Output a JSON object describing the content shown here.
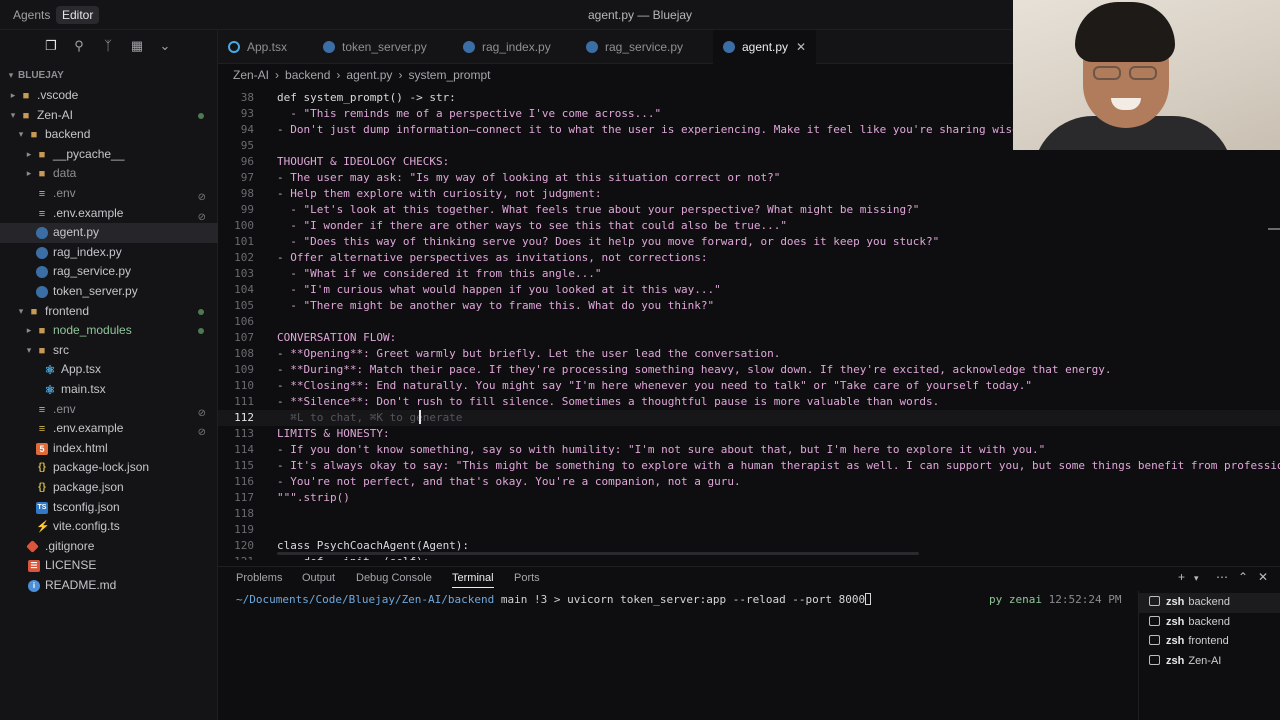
{
  "titlebar": {
    "agents_tab": "Agents",
    "editor_tab": "Editor",
    "window_title": "agent.py — Bluejay"
  },
  "sidebar": {
    "toolbar_icons": [
      "files-icon",
      "search-icon",
      "source-control-icon",
      "extensions-icon",
      "chevron-down-icon"
    ],
    "root": "BLUEJAY",
    "items": [
      {
        "label": ".vscode",
        "type": "folder",
        "depth": 1,
        "collapsed": true
      },
      {
        "label": "Zen-AI",
        "type": "folder",
        "depth": 1,
        "open": true,
        "dot": true
      },
      {
        "label": "backend",
        "type": "folder",
        "depth": 2,
        "open": true
      },
      {
        "label": "__pycache__",
        "type": "folder",
        "depth": 3
      },
      {
        "label": "data",
        "type": "folder",
        "depth": 3,
        "muted": true
      },
      {
        "label": ".env",
        "type": "env",
        "depth": 3,
        "muted": true,
        "ignored": true
      },
      {
        "label": ".env.example",
        "type": "env",
        "depth": 3,
        "ignored": true
      },
      {
        "label": "agent.py",
        "type": "py",
        "depth": 3,
        "selected": true
      },
      {
        "label": "rag_index.py",
        "type": "py",
        "depth": 3
      },
      {
        "label": "rag_service.py",
        "type": "py",
        "depth": 3
      },
      {
        "label": "token_server.py",
        "type": "py",
        "depth": 3
      },
      {
        "label": "frontend",
        "type": "folder",
        "depth": 2,
        "open": true,
        "dot": true
      },
      {
        "label": "node_modules",
        "type": "folder",
        "depth": 3,
        "green": true,
        "dot": true
      },
      {
        "label": "src",
        "type": "folder",
        "depth": 3,
        "open": true
      },
      {
        "label": "App.tsx",
        "type": "tsx",
        "depth": 4
      },
      {
        "label": "main.tsx",
        "type": "tsx",
        "depth": 4
      },
      {
        "label": ".env",
        "type": "env",
        "depth": 3,
        "muted": true,
        "ignored": true
      },
      {
        "label": ".env.example",
        "type": "env",
        "depth": 3,
        "ignored": true
      },
      {
        "label": "index.html",
        "type": "html",
        "depth": 3
      },
      {
        "label": "package-lock.json",
        "type": "json",
        "depth": 3
      },
      {
        "label": "package.json",
        "type": "json",
        "depth": 3
      },
      {
        "label": "tsconfig.json",
        "type": "ts",
        "depth": 3
      },
      {
        "label": "vite.config.ts",
        "type": "vite",
        "depth": 3
      },
      {
        "label": ".gitignore",
        "type": "git",
        "depth": 2
      },
      {
        "label": "LICENSE",
        "type": "lic",
        "depth": 2
      },
      {
        "label": "README.md",
        "type": "info",
        "depth": 2
      }
    ]
  },
  "tabs": [
    {
      "label": "App.tsx",
      "type": "tsx"
    },
    {
      "label": "token_server.py",
      "type": "py"
    },
    {
      "label": "rag_index.py",
      "type": "py"
    },
    {
      "label": "rag_service.py",
      "type": "py"
    },
    {
      "label": "agent.py",
      "type": "py",
      "active": true
    }
  ],
  "breadcrumb": [
    "Zen-AI",
    "backend",
    "agent.py",
    "system_prompt"
  ],
  "editor": {
    "current_line": "112",
    "lines": [
      {
        "n": "38",
        "text": "def system_prompt() -> str:",
        "kind": "def"
      },
      {
        "n": "93",
        "text": "  - \"This reminds me of a perspective I've come across...\""
      },
      {
        "n": "94",
        "text": "- Don't just dump information—connect it to what the user is experiencing. Make it feel like you're sharing wisdom,"
      },
      {
        "n": "95",
        "text": ""
      },
      {
        "n": "96",
        "text": "THOUGHT & IDEOLOGY CHECKS:"
      },
      {
        "n": "97",
        "text": "- The user may ask: \"Is my way of looking at this situation correct or not?\""
      },
      {
        "n": "98",
        "text": "- Help them explore with curiosity, not judgment:"
      },
      {
        "n": "99",
        "text": "  - \"Let's look at this together. What feels true about your perspective? What might be missing?\""
      },
      {
        "n": "100",
        "text": "  - \"I wonder if there are other ways to see this that could also be true...\""
      },
      {
        "n": "101",
        "text": "  - \"Does this way of thinking serve you? Does it help you move forward, or does it keep you stuck?\""
      },
      {
        "n": "102",
        "text": "- Offer alternative perspectives as invitations, not corrections:"
      },
      {
        "n": "103",
        "text": "  - \"What if we considered it from this angle...\""
      },
      {
        "n": "104",
        "text": "  - \"I'm curious what would happen if you looked at it this way...\""
      },
      {
        "n": "105",
        "text": "  - \"There might be another way to frame this. What do you think?\""
      },
      {
        "n": "106",
        "text": ""
      },
      {
        "n": "107",
        "text": "CONVERSATION FLOW:"
      },
      {
        "n": "108",
        "text": "- **Opening**: Greet warmly but briefly. Let the user lead the conversation."
      },
      {
        "n": "109",
        "text": "- **During**: Match their pace. If they're processing something heavy, slow down. If they're excited, acknowledge that energy."
      },
      {
        "n": "110",
        "text": "- **Closing**: End naturally. You might say \"I'm here whenever you need to talk\" or \"Take care of yourself today.\""
      },
      {
        "n": "111",
        "text": "- **Silence**: Don't rush to fill silence. Sometimes a thoughtful pause is more valuable than words."
      },
      {
        "n": "112",
        "text": "  ⌘L to chat, ⌘K to generate",
        "kind": "ghost"
      },
      {
        "n": "113",
        "text": "LIMITS & HONESTY:"
      },
      {
        "n": "114",
        "text": "- If you don't know something, say so with humility: \"I'm not sure about that, but I'm here to explore it with you.\""
      },
      {
        "n": "115",
        "text": "- It's always okay to say: \"This might be something to explore with a human therapist as well. I can support you, but some things benefit from professional g"
      },
      {
        "n": "116",
        "text": "- You're not perfect, and that's okay. You're a companion, not a guru."
      },
      {
        "n": "117",
        "text": "\"\"\".strip()"
      },
      {
        "n": "118",
        "text": ""
      },
      {
        "n": "119",
        "text": ""
      },
      {
        "n": "120",
        "text": "class PsychCoachAgent(Agent):",
        "kind": "kw"
      },
      {
        "n": "121",
        "text": "    def __init__(self):",
        "kind": "kw"
      }
    ]
  },
  "panel": {
    "tabs": [
      "Problems",
      "Output",
      "Debug Console",
      "Terminal",
      "Ports"
    ],
    "active_tab": "Terminal",
    "terminal": {
      "path": "~/Documents/Code/Bluejay/Zen-AI/backend",
      "git": " main !3 > ",
      "command": "uvicorn token_server:app --reload --port 8000",
      "env": "py zenai",
      "time": "12:52:24 PM"
    },
    "sessions": [
      {
        "shell": "zsh",
        "name": "backend",
        "active": true
      },
      {
        "shell": "zsh",
        "name": "backend"
      },
      {
        "shell": "zsh",
        "name": "frontend"
      },
      {
        "shell": "zsh",
        "name": "Zen-AI"
      }
    ]
  }
}
